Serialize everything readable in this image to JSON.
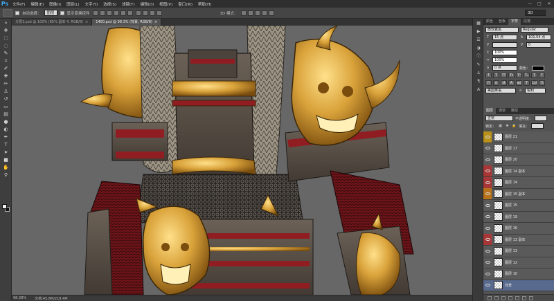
{
  "app": {
    "logo": "Ps"
  },
  "menu": [
    "文件(F)",
    "编辑(E)",
    "图像(I)",
    "图层(L)",
    "文字(Y)",
    "选择(S)",
    "滤镜(T)",
    "编辑(D)",
    "视图(V)",
    "窗口(W)",
    "帮助(H)"
  ],
  "window_controls": [
    "—",
    "□",
    "✕"
  ],
  "options": {
    "auto_select_label": "自动选择：",
    "auto_select_value": "图层",
    "show_transform_label": "显示变换控件",
    "mode_3d_label": "3D 模式：",
    "workspace": "3D"
  },
  "tabs": [
    {
      "label": "分层3.psd @ 100% (85% 副本 4, RGB/8)",
      "close": "×"
    },
    {
      "label": "1400.psd @ 98.3% (背景, RGB/8)",
      "close": "×"
    }
  ],
  "status": {
    "zoom": "98.28%",
    "doc": "文档:45.8M/218.4M"
  },
  "panels": {
    "top_tabs": [
      "颜色",
      "色板",
      "字符",
      "段落"
    ],
    "active_top_tab": 2,
    "font_family": "微软雅黑",
    "font_style": "Regular",
    "font_size": "15 点",
    "leading": "101.54 点",
    "tracking": "0",
    "scale_v": "100%",
    "scale_h": "100%",
    "baseline": "0 点",
    "color_label": "颜色：",
    "language": "美国英语",
    "antialias": "锐利",
    "layer_tabs": [
      "图层",
      "通道",
      "路径"
    ],
    "blend_mode": "正常",
    "opacity_label": "不透明度：",
    "lock_label": "锁定：",
    "fill_label": "填充："
  },
  "layers": [
    {
      "name": "图层 21",
      "color": "#b8901a",
      "visible": true
    },
    {
      "name": "图层 17",
      "color": "",
      "visible": true
    },
    {
      "name": "图层 20",
      "color": "",
      "visible": true
    },
    {
      "name": "图层 14 副本",
      "color": "#a83636",
      "visible": true
    },
    {
      "name": "图层 14",
      "color": "#a83636",
      "visible": true
    },
    {
      "name": "图层 15 副本",
      "color": "#b8731a",
      "visible": true
    },
    {
      "name": "图层 15",
      "color": "",
      "visible": true
    },
    {
      "name": "图层 19",
      "color": "",
      "visible": true
    },
    {
      "name": "图层 16",
      "color": "",
      "visible": true
    },
    {
      "name": "图层 13 副本",
      "color": "#a83636",
      "visible": true
    },
    {
      "name": "图层 13",
      "color": "",
      "visible": true
    },
    {
      "name": "图层 12",
      "color": "",
      "visible": true
    },
    {
      "name": "图层 10",
      "color": "",
      "visible": true
    },
    {
      "name": "背景",
      "color": "",
      "visible": true,
      "selected": true
    }
  ],
  "colors": {
    "gold": "#d9a23a",
    "gold_dark": "#8a5a12",
    "armor_red": "#8f1d22",
    "armor_grey": "#5b5148",
    "fur": "#a39b8a"
  }
}
